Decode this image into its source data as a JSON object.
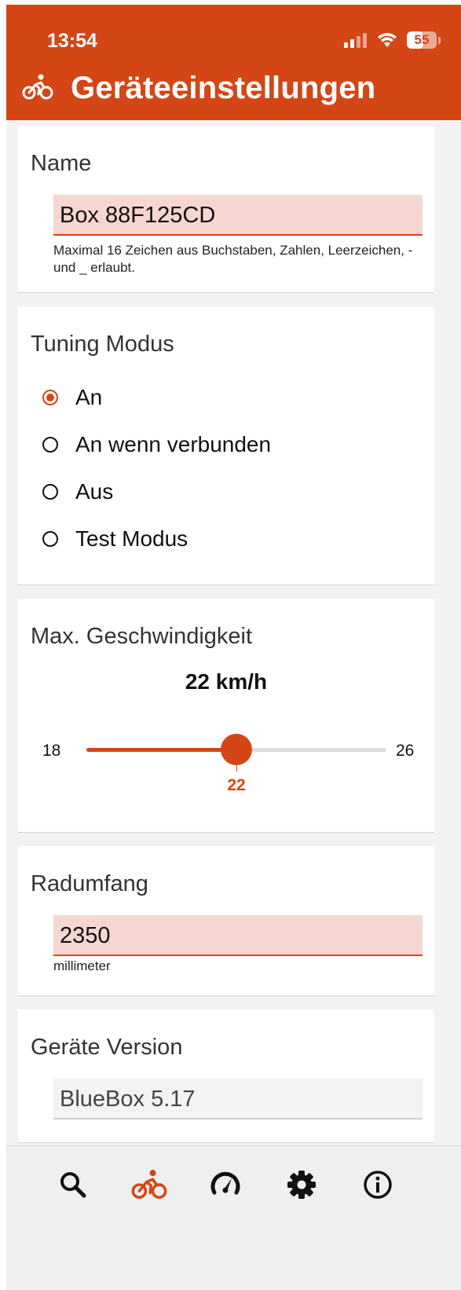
{
  "status_bar": {
    "time": "13:54",
    "battery": "55",
    "battery_level": 0.55
  },
  "app_bar": {
    "title": "Geräteeinstellungen",
    "icon": "bicycle-icon"
  },
  "name_section": {
    "title": "Name",
    "value": "Box 88F125CD",
    "hint": "Maximal 16 Zeichen aus Buchstaben, Zahlen, Leerzeichen, - und _ erlaubt."
  },
  "tuning_section": {
    "title": "Tuning Modus",
    "options": [
      {
        "label": "An",
        "selected": true
      },
      {
        "label": "An wenn verbunden",
        "selected": false
      },
      {
        "label": "Aus",
        "selected": false
      },
      {
        "label": "Test Modus",
        "selected": false
      }
    ]
  },
  "speed_section": {
    "title": "Max. Geschwindigkeit",
    "value_label": "22 km/h",
    "slider": {
      "min": 18,
      "max": 26,
      "value": 22,
      "min_label": "18",
      "max_label": "26",
      "value_label": "22"
    }
  },
  "wheel_section": {
    "title": "Radumfang",
    "value": "2350",
    "unit": "millimeter"
  },
  "version_section": {
    "title": "Geräte Version",
    "value": "BlueBox 5.17"
  },
  "bottom_nav": {
    "items": [
      {
        "icon": "search-icon",
        "active": false
      },
      {
        "icon": "bicycle-icon",
        "active": true
      },
      {
        "icon": "speedometer-icon",
        "active": false
      },
      {
        "icon": "gear-icon",
        "active": false
      },
      {
        "icon": "info-icon",
        "active": false
      }
    ]
  },
  "colors": {
    "accent": "#d44615",
    "error_fill": "#f6d6d0",
    "background": "#f2f2f2"
  }
}
